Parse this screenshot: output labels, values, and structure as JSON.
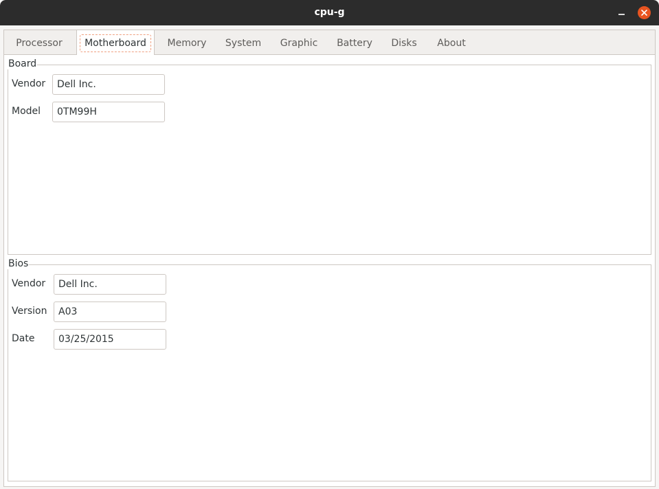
{
  "window": {
    "title": "cpu-g"
  },
  "tabs": [
    {
      "label": "Processor"
    },
    {
      "label": "Motherboard"
    },
    {
      "label": "Memory"
    },
    {
      "label": "System"
    },
    {
      "label": "Graphic"
    },
    {
      "label": "Battery"
    },
    {
      "label": "Disks"
    },
    {
      "label": "About"
    }
  ],
  "active_tab": "Motherboard",
  "board": {
    "legend": "Board",
    "vendor_label": "Vendor",
    "vendor_value": "Dell Inc.",
    "model_label": "Model",
    "model_value": "0TM99H"
  },
  "bios": {
    "legend": "Bios",
    "vendor_label": "Vendor",
    "vendor_value": "Dell Inc.",
    "version_label": "Version",
    "version_value": "A03",
    "date_label": "Date",
    "date_value": "03/25/2015"
  },
  "colors": {
    "titlebar": "#2c2c2c",
    "close_button": "#e95420",
    "focus_outline": "#f0a080"
  },
  "icons": [
    "minimize-icon",
    "close-icon"
  ]
}
